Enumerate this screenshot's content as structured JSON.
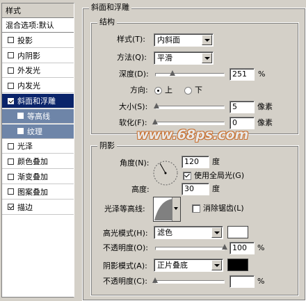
{
  "left_panel": {
    "header": "样式",
    "items": [
      {
        "label": "混合选项:默认",
        "checkbox": false,
        "checked": false,
        "state": "header"
      },
      {
        "label": "投影",
        "checkbox": true,
        "checked": false,
        "state": "normal"
      },
      {
        "label": "内阴影",
        "checkbox": true,
        "checked": false,
        "state": "normal"
      },
      {
        "label": "外发光",
        "checkbox": true,
        "checked": false,
        "state": "normal"
      },
      {
        "label": "内发光",
        "checkbox": true,
        "checked": false,
        "state": "normal"
      },
      {
        "label": "斜面和浮雕",
        "checkbox": true,
        "checked": true,
        "state": "selected"
      },
      {
        "label": "等高线",
        "checkbox": true,
        "checked": false,
        "state": "sub"
      },
      {
        "label": "纹理",
        "checkbox": true,
        "checked": false,
        "state": "sub"
      },
      {
        "label": "光泽",
        "checkbox": true,
        "checked": false,
        "state": "normal"
      },
      {
        "label": "颜色叠加",
        "checkbox": true,
        "checked": false,
        "state": "normal"
      },
      {
        "label": "渐变叠加",
        "checkbox": true,
        "checked": false,
        "state": "normal"
      },
      {
        "label": "图案叠加",
        "checkbox": true,
        "checked": false,
        "state": "normal"
      },
      {
        "label": "描边",
        "checkbox": true,
        "checked": true,
        "state": "normal"
      }
    ]
  },
  "bevel": {
    "title": "斜面和浮雕",
    "structure": {
      "title": "结构",
      "style_label": "样式(T):",
      "style_value": "内斜面",
      "technique_label": "方法(Q):",
      "technique_value": "平滑",
      "depth_label": "深度(D):",
      "depth_value": "251",
      "depth_unit": "%",
      "depth_level": 0.25,
      "direction_label": "方向:",
      "direction_up": "上",
      "direction_down": "下",
      "size_label": "大小(S):",
      "size_value": "5",
      "size_unit": "像素",
      "size_level": 0.02,
      "soften_label": "软化(F):",
      "soften_value": "0",
      "soften_unit": "像素",
      "soften_level": 0.0
    },
    "shading": {
      "title": "阴影",
      "angle_label": "角度(N):",
      "angle_value": "120",
      "angle_unit": "度",
      "global_light_label": "使用全局光(G)",
      "global_light_checked": true,
      "altitude_label": "高度:",
      "altitude_value": "30",
      "altitude_unit": "度",
      "gloss_contour_label": "光泽等高线:",
      "antialias_label": "消除锯齿(L)",
      "antialias_checked": false,
      "highlight_mode_label": "高光模式(H):",
      "highlight_mode_value": "滤色",
      "highlight_color": "#ffffff",
      "highlight_opacity_label": "不透明度(O):",
      "highlight_opacity_value": "100",
      "highlight_opacity_level": 1.0,
      "shadow_mode_label": "阴影模式(A):",
      "shadow_mode_value": "正片叠底",
      "shadow_color": "#000000",
      "shadow_opacity_label": "不透明度(C):",
      "shadow_opacity_unit": "%",
      "highlight_opacity_unit": "%"
    }
  },
  "watermark": "www.68ps.com"
}
